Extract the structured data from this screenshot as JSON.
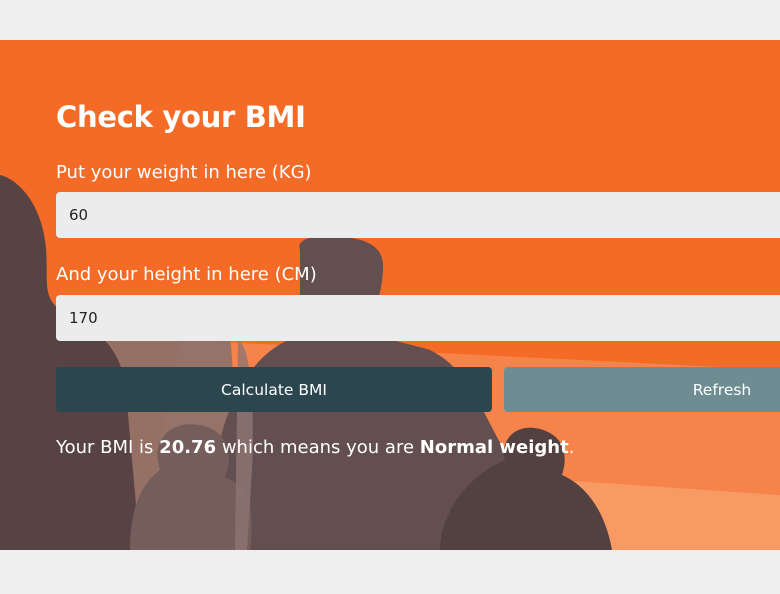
{
  "form": {
    "title": "Check your BMI",
    "weight_label": "Put your weight in here (KG)",
    "weight_value": "60",
    "height_label": "And your height in here (CM)",
    "height_value": "170",
    "calculate_label": "Calculate BMI",
    "refresh_label": "Refresh"
  },
  "result": {
    "prefix": "Your BMI is ",
    "bmi": "20.76",
    "middle": " which means you are ",
    "category": "Normal weight",
    "suffix": "."
  },
  "colors": {
    "page_background": "#efefef",
    "panel_orange": "#f36b26",
    "calculate_button": "#2c4650",
    "refresh_button": "#6e8d93",
    "input_background": "#ececec"
  }
}
